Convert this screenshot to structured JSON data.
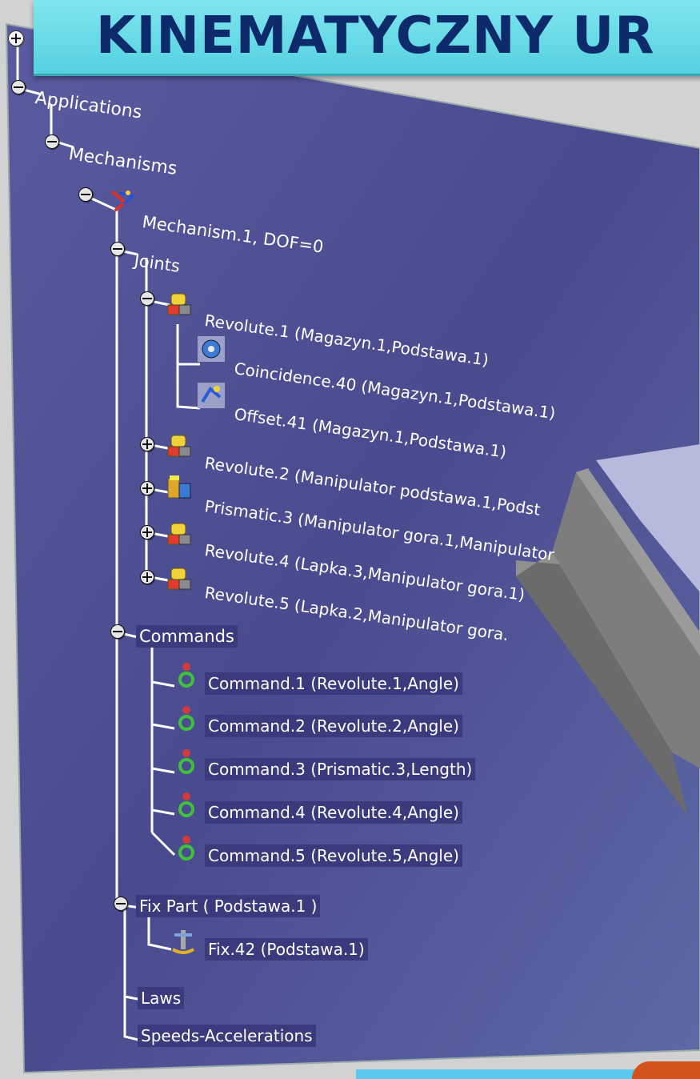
{
  "title": "KINEMATYCZNY UR",
  "tree": {
    "applications": "Applications",
    "mechanisms": "Mechanisms",
    "mechanism": "Mechanism.1, DOF=0",
    "joints": "Joints",
    "joint_items": [
      {
        "label": "Revolute.1 (Magazyn.1,Podstawa.1)",
        "icon": "revolute-joint-icon",
        "expanded": true
      },
      {
        "label": "Revolute.2 (Manipulator podstawa.1,Podst",
        "icon": "revolute-joint-icon",
        "expanded": false
      },
      {
        "label": "Prismatic.3 (Manipulator gora.1,Manipulator",
        "icon": "prismatic-joint-icon",
        "expanded": false
      },
      {
        "label": "Revolute.4 (Lapka.3,Manipulator gora.1)",
        "icon": "revolute-joint-icon",
        "expanded": false
      },
      {
        "label": "Revolute.5 (Lapka.2,Manipulator gora.",
        "icon": "revolute-joint-icon",
        "expanded": false
      }
    ],
    "constraints": [
      {
        "label": "Coincidence.40 (Magazyn.1,Podstawa.1)",
        "icon": "coincidence-icon"
      },
      {
        "label": "Offset.41 (Magazyn.1,Podstawa.1)",
        "icon": "offset-icon"
      }
    ],
    "commands": "Commands",
    "command_items": [
      "Command.1 (Revolute.1,Angle)",
      "Command.2 (Revolute.2,Angle)",
      "Command.3 (Prismatic.3,Length)",
      "Command.4 (Revolute.4,Angle)",
      "Command.5 (Revolute.5,Angle)"
    ],
    "fix_part": "Fix Part ( Podstawa.1 )",
    "fix_item": "Fix.42 (Podstawa.1)",
    "laws": "Laws",
    "speeds": "Speeds-Accelerations"
  },
  "colors": {
    "panel": "#4a4a8e",
    "banner": "#66d9e6",
    "title_text": "#0d2a6b",
    "label_bg": "#3a3a7c",
    "gray_beam": "#8a8a8a"
  }
}
